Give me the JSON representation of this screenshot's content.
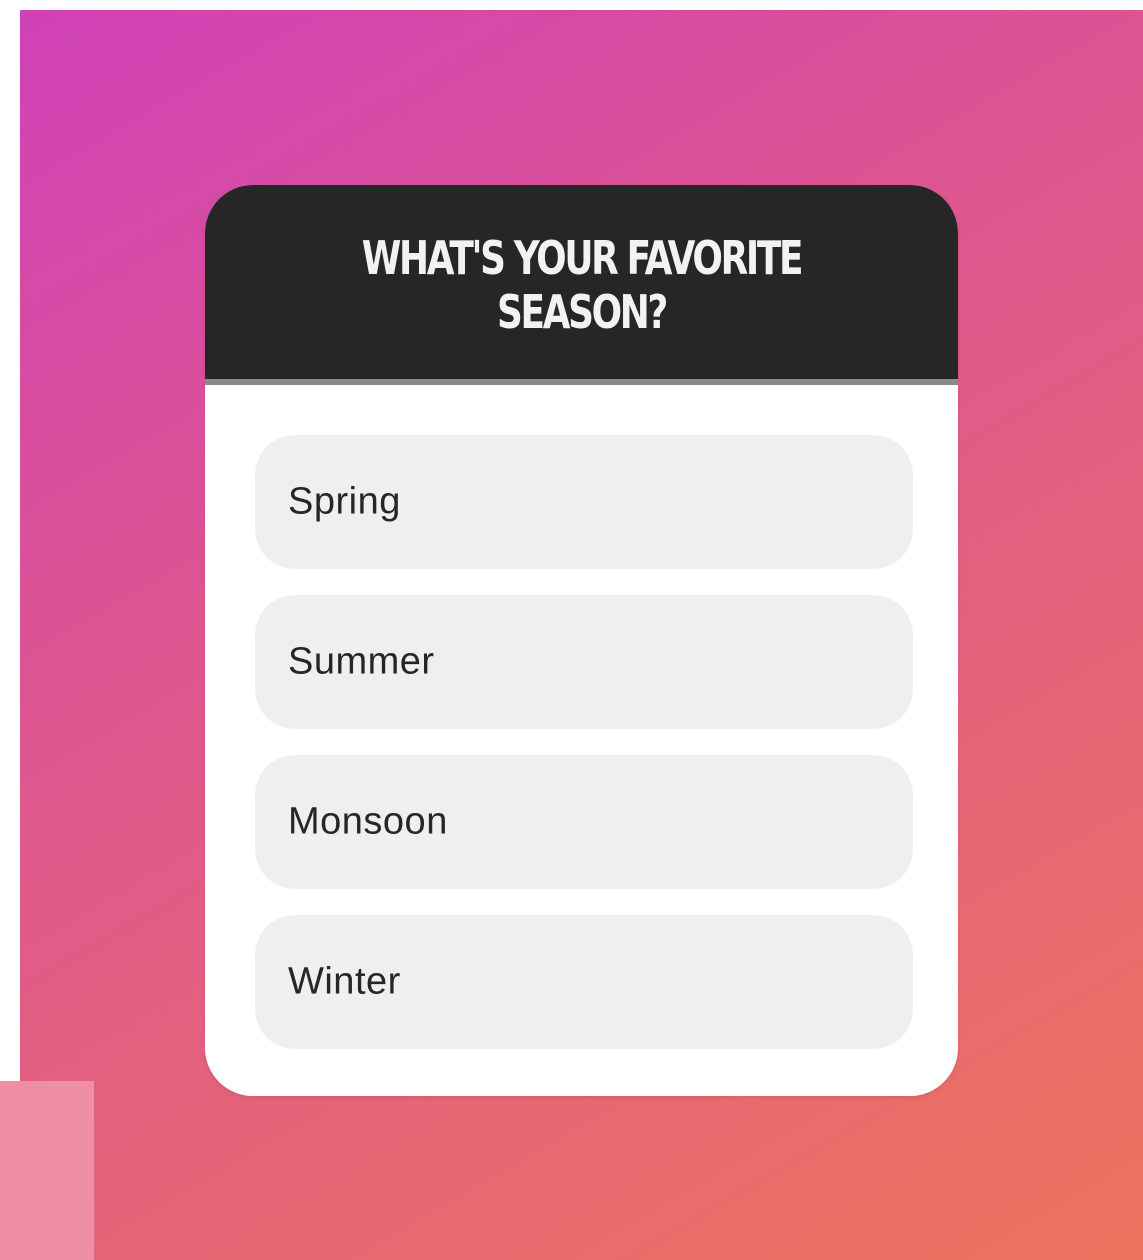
{
  "colors": {
    "gradient_start": "#d042b8",
    "gradient_end": "#ee745e",
    "header_background": "#262626",
    "header_text": "#f2f2f2",
    "option_background": "#efefef",
    "option_text": "#262626",
    "corner_block": "#ee8fa5"
  },
  "quiz": {
    "question": "WHAT'S YOUR FAVORITE SEASON?",
    "options": [
      {
        "label": "Spring"
      },
      {
        "label": "Summer"
      },
      {
        "label": "Monsoon"
      },
      {
        "label": "Winter"
      }
    ]
  }
}
